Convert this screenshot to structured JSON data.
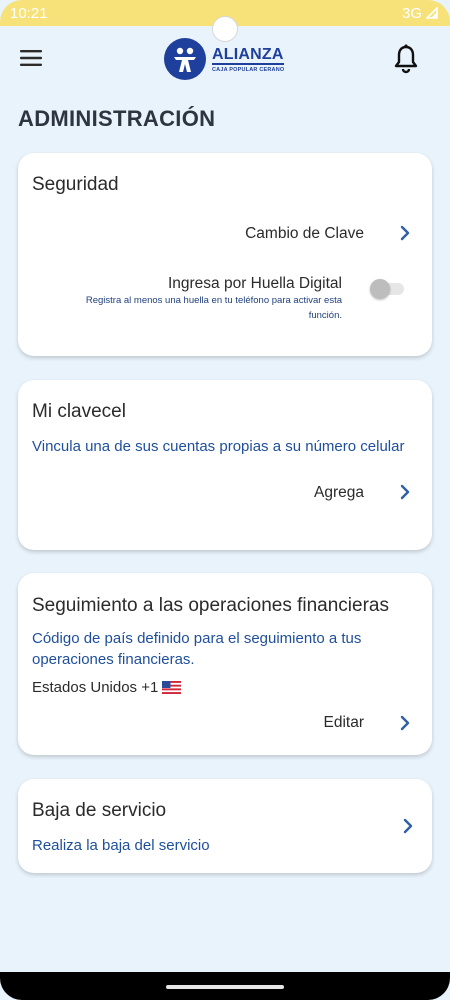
{
  "status_bar": {
    "time": "10:21",
    "network": "3G"
  },
  "header": {
    "logo_name": "ALIANZA",
    "logo_subtitle": "CAJA POPULAR CERANO",
    "page_title": "ADMINISTRACIÓN"
  },
  "security_card": {
    "title": "Seguridad",
    "password_change_label": "Cambio de Clave",
    "fingerprint_label": "Ingresa por Huella Digital",
    "fingerprint_hint_line1": "Registra al menos una huella en tu teléfono para activar esta",
    "fingerprint_hint_line2": "función.",
    "fingerprint_enabled": false
  },
  "clavecel_card": {
    "title": "Mi clavecel",
    "description": "Vincula una de sus cuentas propias a su número celular",
    "action_label": "Agrega"
  },
  "tracking_card": {
    "title": "Seguimiento a las operaciones financieras",
    "description_line1": "Código de país definido para el seguimiento a tus",
    "description_line2": "operaciones financieras.",
    "country": "Estados Unidos +1",
    "action_label": "Editar"
  },
  "cancel_card": {
    "title": "Baja de servicio",
    "description": "Realiza la baja del servicio"
  },
  "colors": {
    "status_bar": "#f7e27a",
    "background": "#e9f3fb",
    "brand_blue": "#1f3f9c",
    "link_blue": "#1f4f9c",
    "chevron_blue": "#2f5fa8"
  },
  "icons": {
    "menu": "menu-icon",
    "notifications": "bell-icon",
    "chevron": "chevron-right-icon",
    "flag": "us-flag-icon"
  }
}
